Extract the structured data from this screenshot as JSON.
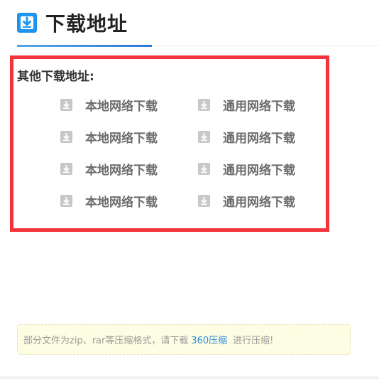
{
  "header": {
    "title": "下载地址",
    "icon": "download-box-icon",
    "icon_color": "#2196f3"
  },
  "links": {
    "heading": "其他下载地址:",
    "rows": [
      {
        "left": "本地网络下载",
        "right": "通用网络下载"
      },
      {
        "left": "本地网络下载",
        "right": "通用网络下载"
      },
      {
        "left": "本地网络下载",
        "right": "通用网络下载"
      },
      {
        "left": "本地网络下载",
        "right": "通用网络下载"
      }
    ],
    "link_icon": "download-icon",
    "highlight_color": "#f5333b"
  },
  "notice": {
    "prefix": "部分文件为zip、rar等压缩格式，请下载",
    "link_text": "360压缩",
    "suffix": "进行压缩!",
    "link_color": "#2f8ad8"
  }
}
